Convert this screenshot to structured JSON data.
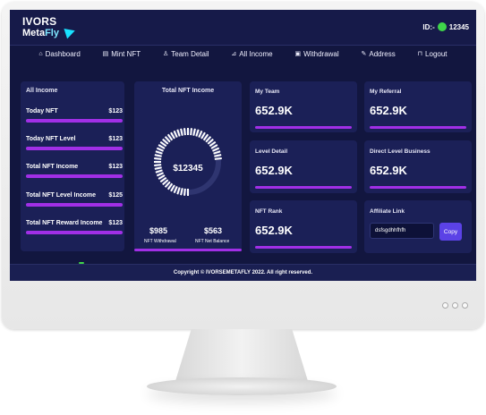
{
  "header": {
    "logo_line1": "IVORS",
    "logo_line2_a": "Meta",
    "logo_line2_b": "Fly",
    "id_label": "ID:-",
    "id_value": "12345"
  },
  "nav": {
    "items": [
      {
        "label": "Dashboard",
        "icon": "home-icon"
      },
      {
        "label": "Mint NFT",
        "icon": "file-icon"
      },
      {
        "label": "Team Detail",
        "icon": "user-icon"
      },
      {
        "label": "All Income",
        "icon": "chart-icon"
      },
      {
        "label": "Withdrawal",
        "icon": "wallet-icon"
      },
      {
        "label": "Address",
        "icon": "edit-icon"
      },
      {
        "label": "Logout",
        "icon": "lock-icon"
      }
    ]
  },
  "all_income": {
    "title": "All Income",
    "rows": [
      {
        "label": "Today NFT",
        "value": "$123"
      },
      {
        "label": "Today NFT Level",
        "value": "$123"
      },
      {
        "label": "Total NFT Income",
        "value": "$123"
      },
      {
        "label": "Total NFT Level Income",
        "value": "$125"
      },
      {
        "label": "Total NFT Reward Income",
        "value": "$123"
      }
    ]
  },
  "total_nft": {
    "title": "Total NFT Income",
    "center_value": "$12345",
    "gauge_fraction": 0.75,
    "left_value": "$985",
    "left_label": "NFT Withdrawal",
    "right_value": "$563",
    "right_label": "NFT Net Balance"
  },
  "stats": {
    "my_team": {
      "label": "My Team",
      "value": "652.9K"
    },
    "my_referral": {
      "label": "My Referral",
      "value": "652.9K"
    },
    "level_detail": {
      "label": "Level Detail",
      "value": "652.9K"
    },
    "direct_level_business": {
      "label": "Direct Level Business",
      "value": "652.9K"
    },
    "nft_rank": {
      "label": "NFT Rank",
      "value": "652.9K"
    }
  },
  "affiliate": {
    "label": "Affiliate Link",
    "value": "dsfsgdhhfhfh",
    "copy_label": "Copy"
  },
  "footer": {
    "text": "Copyright © IVORSEMETAFLY 2022. All right reserved."
  },
  "colors": {
    "screen_bg": "#12163f",
    "card_bg": "#1b2057",
    "accent_purple": "#a12fe6",
    "button_blue": "#5b42e6",
    "online_green": "#3fd54a"
  }
}
